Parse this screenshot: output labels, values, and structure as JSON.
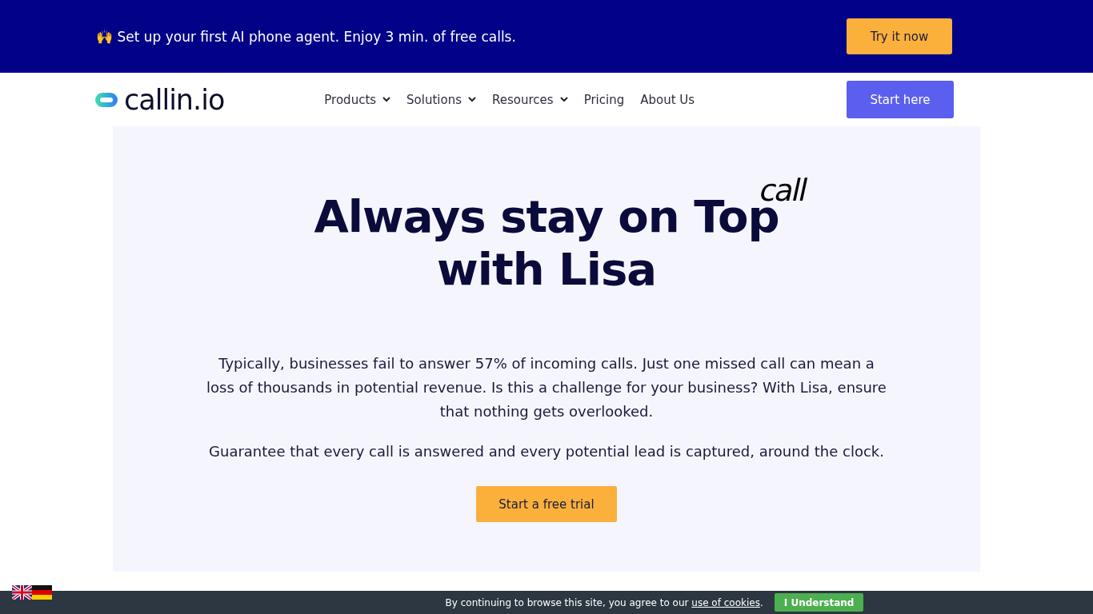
{
  "promo_bar": {
    "emoji": "🙌",
    "text": "Set up your first AI phone agent. Enjoy 3 min. of free calls.",
    "button": "Try it now"
  },
  "header": {
    "logo": "callin.io",
    "nav": [
      {
        "label": "Products",
        "dropdown": true
      },
      {
        "label": "Solutions",
        "dropdown": true
      },
      {
        "label": "Resources",
        "dropdown": true
      },
      {
        "label": "Pricing",
        "dropdown": false
      },
      {
        "label": "About Us",
        "dropdown": false
      }
    ],
    "button": "Start here"
  },
  "hero": {
    "title_line_1": "Always stay on Top",
    "title_line_2": "with Lisa",
    "rotating_word": "call",
    "paragraphs": [
      "Typically, businesses fail to answer 57% of incoming calls. Just one missed call can mean a loss of thousands in potential revenue. Is this a challenge for your business? With Lisa, ensure that nothing gets overlooked.",
      "Guarantee that every call is answered and every potential lead is captured, around the clock."
    ],
    "button": "Start a free trial"
  },
  "cookie_bar": {
    "text_before": "By continuing to browse this site, you agree to our ",
    "link": "use of cookies",
    "text_after": ".",
    "button": "I Understand"
  },
  "languages": [
    {
      "kind": "uk"
    },
    {
      "kind": "de"
    }
  ]
}
